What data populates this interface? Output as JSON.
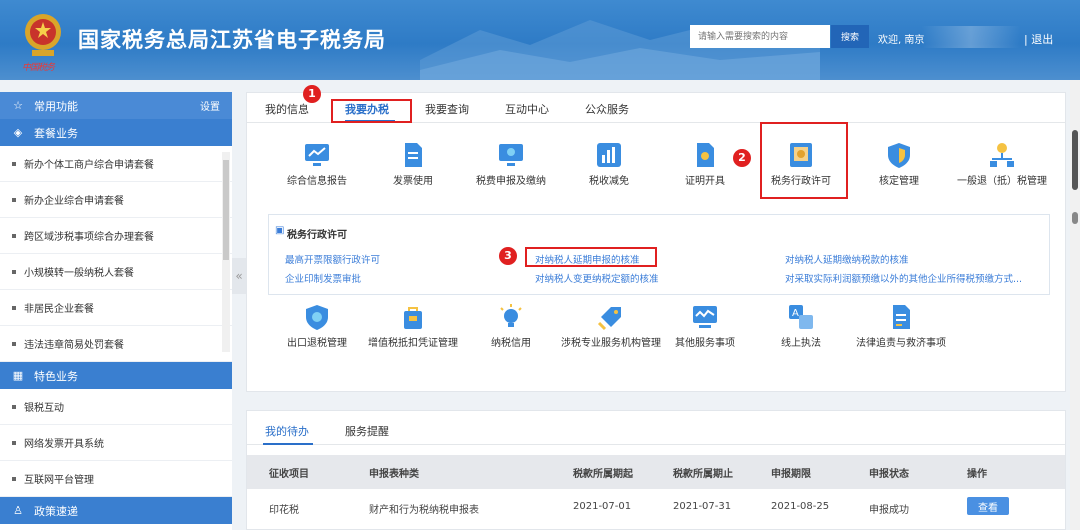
{
  "header": {
    "brand_sub": "中国税务",
    "site_title": "国家税务总局江苏省电子税务局",
    "search_placeholder": "请输入需要搜索的内容",
    "search_button": "搜索",
    "welcome": "欢迎, 南京",
    "logout": "| 退出"
  },
  "sidebar": {
    "common_label": "常用功能",
    "setting_label": "设置",
    "package_label": "套餐业务",
    "package_items": [
      "新办个体工商户综合申请套餐",
      "新办企业综合申请套餐",
      "跨区域涉税事项综合办理套餐",
      "小规模转一般纳税人套餐",
      "非居民企业套餐",
      "违法违章简易处罚套餐"
    ],
    "special_label": "特色业务",
    "special_items": [
      "银税互动",
      "网络发票开具系统",
      "互联网平台管理"
    ],
    "policy_label": "政策速递"
  },
  "tabs": [
    "我的信息",
    "我要办税",
    "我要查询",
    "互动中心",
    "公众服务"
  ],
  "services_row1": [
    "综合信息报告",
    "发票使用",
    "税费申报及缴纳",
    "税收减免",
    "证明开具",
    "税务行政许可",
    "核定管理",
    "一般退（抵）税管理"
  ],
  "services_row2": [
    "出口退税管理",
    "增值税抵扣凭证管理",
    "纳税信用",
    "涉税专业服务机构管理",
    "其他服务事项",
    "线上执法",
    "法律追责与救济事项"
  ],
  "subpanel": {
    "title": "税务行政许可",
    "links": [
      "最高开票限额行政许可",
      "企业印制发票审批",
      "对纳税人延期申报的核准",
      "对纳税人变更纳税定额的核准",
      "对纳税人延期缴纳税款的核准",
      "对采取实际利润额预缴以外的其他企业所得税预缴方式..."
    ]
  },
  "badges": [
    "1",
    "2",
    "3"
  ],
  "bottom": {
    "tabs": [
      "我的待办",
      "服务提醒"
    ],
    "headers": [
      "征收项目",
      "申报表种类",
      "税款所属期起",
      "税款所属期止",
      "申报期限",
      "申报状态",
      "操作"
    ],
    "row": [
      "印花税",
      "财产和行为税纳税申报表",
      "2021-07-01",
      "2021-07-31",
      "2021-08-25",
      "申报成功"
    ],
    "view_button": "查看"
  },
  "colors": {
    "primary": "#2a6fc9",
    "header": "#2e7bc6",
    "highlight": "#e02020"
  }
}
